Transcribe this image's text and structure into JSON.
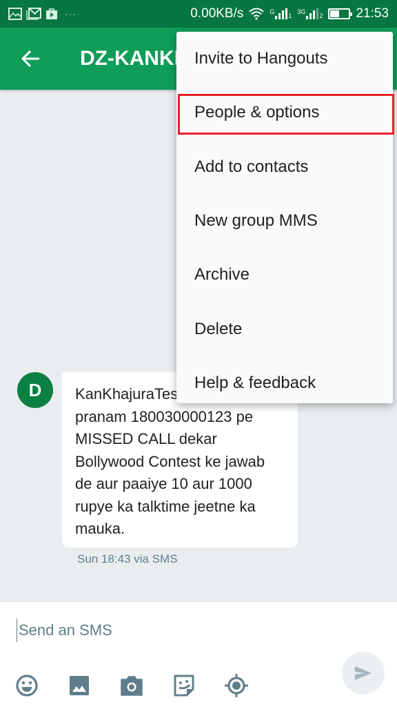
{
  "status_bar": {
    "notification_icons": [
      "image-icon",
      "gmail-icon",
      "play-store-icon"
    ],
    "more_indicator": "···",
    "network_speed": "0.00KB/s",
    "sim1_label": "G",
    "sim1_index": "1",
    "sim2_label": "3G",
    "sim2_index": "2",
    "battery_level": 0.45,
    "time": "21:53"
  },
  "app_bar": {
    "title": "DZ-KANKHJ",
    "back_icon": "arrow-back-icon",
    "color": "#0f9d58"
  },
  "overflow_menu": {
    "items": [
      {
        "label": "Invite to Hangouts",
        "highlighted": false
      },
      {
        "label": "People & options",
        "highlighted": true
      },
      {
        "label": "Add to contacts",
        "highlighted": false
      },
      {
        "label": "New group MMS",
        "highlighted": false
      },
      {
        "label": "Archive",
        "highlighted": false
      },
      {
        "label": "Delete",
        "highlighted": false
      },
      {
        "label": "Help & feedback",
        "highlighted": false
      }
    ]
  },
  "conversation": {
    "messages": [
      {
        "avatar_letter": "D",
        "avatar_color": "#0b8043",
        "lines": [
          "KanKhajuraTesan ko",
          "pranam 180030000123 pe",
          "MISSED CALL dekar",
          "Bollywood Contest ke jawab",
          "de aur paaiye 10 aur 1000",
          "rupye ka talktime jeetne ka",
          "mauka."
        ],
        "timestamp": "Sun 18:43 via SMS"
      }
    ]
  },
  "compose": {
    "placeholder": "Send an SMS",
    "value": "",
    "tools": [
      "emoji-icon",
      "gallery-icon",
      "camera-icon",
      "sticker-icon",
      "location-icon"
    ],
    "send_icon": "send-icon"
  }
}
